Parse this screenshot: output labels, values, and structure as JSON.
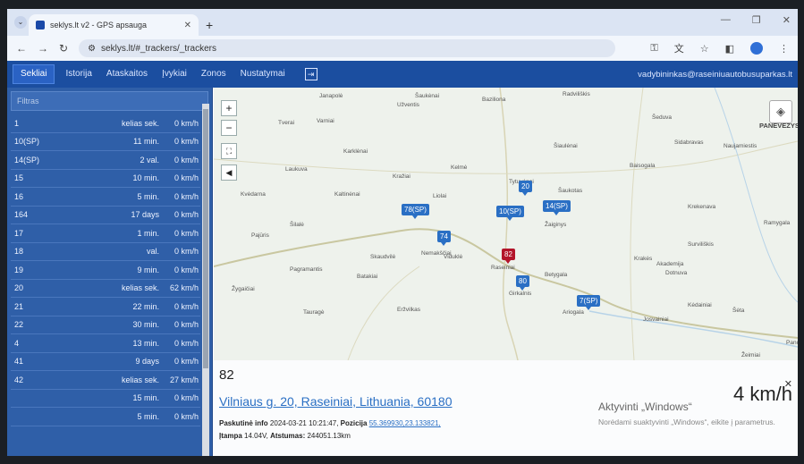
{
  "browser": {
    "tab_title": "seklys.lt v2 - GPS apsauga",
    "url": "seklys.lt/#_trackers/_trackers"
  },
  "nav": {
    "items": [
      "Sekliai",
      "Istorija",
      "Ataskaitos",
      "Įvykiai",
      "Zonos",
      "Nustatymai"
    ],
    "active": "Sekliai",
    "user": "vadybininkas@raseiniuautobusuparkas.lt"
  },
  "sidebar": {
    "filter_placeholder": "Filtras",
    "rows": [
      {
        "name": "1",
        "info": "kelias sek.",
        "speed": "0 km/h"
      },
      {
        "name": "10(SP)",
        "info": "11 min.",
        "speed": "0 km/h"
      },
      {
        "name": "14(SP)",
        "info": "2 val.",
        "speed": "0 km/h"
      },
      {
        "name": "15",
        "info": "10 min.",
        "speed": "0 km/h"
      },
      {
        "name": "16",
        "info": "5 min.",
        "speed": "0 km/h"
      },
      {
        "name": "164",
        "info": "17 days",
        "speed": "0 km/h"
      },
      {
        "name": "17",
        "info": "1 min.",
        "speed": "0 km/h"
      },
      {
        "name": "18",
        "info": "val.",
        "speed": "0 km/h"
      },
      {
        "name": "19",
        "info": "9 min.",
        "speed": "0 km/h"
      },
      {
        "name": "20",
        "info": "kelias sek.",
        "speed": "62 km/h"
      },
      {
        "name": "21",
        "info": "22 min.",
        "speed": "0 km/h"
      },
      {
        "name": "22",
        "info": "30 min.",
        "speed": "0 km/h"
      },
      {
        "name": "4",
        "info": "13 min.",
        "speed": "0 km/h"
      },
      {
        "name": "41",
        "info": "9 days",
        "speed": "0 km/h"
      },
      {
        "name": "42",
        "info": "kelias sek.",
        "speed": "27 km/h"
      },
      {
        "name": "",
        "info": "15 min.",
        "speed": "0 km/h"
      },
      {
        "name": "",
        "info": "5 min.",
        "speed": "0 km/h"
      }
    ]
  },
  "map": {
    "towns": [
      {
        "name": "Janapolė"
      },
      {
        "name": "Užventis"
      },
      {
        "name": "Šaukėnai"
      },
      {
        "name": "Baziliona"
      },
      {
        "name": "Radviliškis"
      },
      {
        "name": "Šeduva"
      },
      {
        "name": "PANEVĖŽYS"
      },
      {
        "name": "Tverai"
      },
      {
        "name": "Varniai"
      },
      {
        "name": "Karklėnai"
      },
      {
        "name": "Šiaulėnai"
      },
      {
        "name": "Sidabravas"
      },
      {
        "name": "Naujamiestis"
      },
      {
        "name": "Laukuva"
      },
      {
        "name": "Kražiai"
      },
      {
        "name": "Kelmė"
      },
      {
        "name": "Baisogala"
      },
      {
        "name": "Kvėdarna"
      },
      {
        "name": "Kaltinėnai"
      },
      {
        "name": "Liolai"
      },
      {
        "name": "Tytuvėnai"
      },
      {
        "name": "Šaukotas"
      },
      {
        "name": "Krekenava"
      },
      {
        "name": "Šilalė"
      },
      {
        "name": "Žaiginys"
      },
      {
        "name": "Ramygala"
      },
      {
        "name": "Pajūris"
      },
      {
        "name": "Nemakščiai"
      },
      {
        "name": "Surviliškis"
      },
      {
        "name": "Skaudvilė"
      },
      {
        "name": "Viduklė"
      },
      {
        "name": "Krakės"
      },
      {
        "name": "Akademija"
      },
      {
        "name": "Pagramantis"
      },
      {
        "name": "Raseiniai"
      },
      {
        "name": "Betygala"
      },
      {
        "name": "Dotnuva"
      },
      {
        "name": "Batakiai"
      },
      {
        "name": "Žygaičiai"
      },
      {
        "name": "Girkalnis"
      },
      {
        "name": "Kėdainiai"
      },
      {
        "name": "Šėta"
      },
      {
        "name": "Tauragė"
      },
      {
        "name": "Eržvilkas"
      },
      {
        "name": "Ariogala"
      },
      {
        "name": "Josvainiai"
      },
      {
        "name": "Žeimiai"
      },
      {
        "name": "Panoš"
      }
    ],
    "markers": [
      {
        "label": "20",
        "color": "#2a6fc4"
      },
      {
        "label": "78(SP)",
        "color": "#2a6fc4"
      },
      {
        "label": "10(SP)",
        "color": "#2a6fc4"
      },
      {
        "label": "14(SP)",
        "color": "#2a6fc4"
      },
      {
        "label": "74",
        "color": "#2a6fc4"
      },
      {
        "label": "82",
        "color": "#b3152a"
      },
      {
        "label": "80",
        "color": "#2a6fc4"
      },
      {
        "label": "7(SP)",
        "color": "#2a6fc4"
      }
    ]
  },
  "panel": {
    "id": "82",
    "address": "Vilniaus g. 20, Raseiniai, Lithuania, 60180",
    "speed": "4 km/h",
    "last_info_label": "Paskutinė info",
    "last_info_value": "2024-03-21 10:21:47,",
    "position_label": "Pozicija",
    "position_value": "55.369930,23.133821,",
    "voltage_label": "Įtampa",
    "voltage_value": "14.04V,",
    "distance_label": "Atstumas:",
    "distance_value": "244051.13km",
    "windows_title": "Aktyvinti „Windows“",
    "windows_text": "Norėdami suaktyvinti „Windows“, eikite į parametrus."
  }
}
